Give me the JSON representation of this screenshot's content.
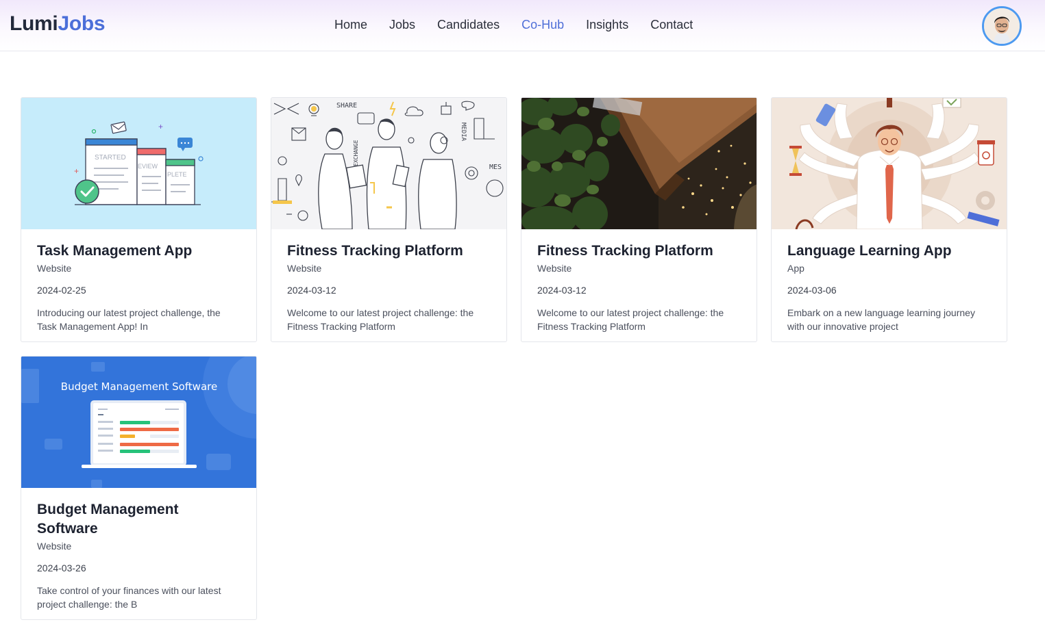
{
  "header": {
    "logo_part1": "Lumi",
    "logo_part2": "Jobs",
    "nav": [
      {
        "label": "Home"
      },
      {
        "label": "Jobs"
      },
      {
        "label": "Candidates"
      },
      {
        "label": "Co-Hub",
        "active": true
      },
      {
        "label": "Insights"
      },
      {
        "label": "Contact"
      }
    ],
    "accent_color": "#4f6fd8"
  },
  "cards": [
    {
      "title": "Task Management App",
      "category": "Website",
      "date": "2024-02-25",
      "description": "Introducing our latest project challenge, the Task Management App! In",
      "thumb_labels": [
        "STARTED",
        "EVIEW",
        "PLETE"
      ]
    },
    {
      "title": "Fitness Tracking Platform",
      "category": "Website",
      "date": "2024-03-12",
      "description": "Welcome to our latest project challenge: the Fitness Tracking Platform",
      "thumb_labels": [
        "SHARE",
        "EXCHANGE",
        "MEDIA",
        "MES"
      ]
    },
    {
      "title": "Fitness Tracking Platform",
      "category": "Website",
      "date": "2024-03-12",
      "description": "Welcome to our latest project challenge: the Fitness Tracking Platform"
    },
    {
      "title": "Language Learning App",
      "category": "App",
      "date": "2024-03-06",
      "description": "Embark on a new language learning journey with our innovative project"
    },
    {
      "title": "Budget Management Software",
      "category": "Website",
      "date": "2024-03-26",
      "description": "Take control of your finances with our latest project challenge: the B",
      "thumb_title": "Budget Management Software"
    }
  ]
}
